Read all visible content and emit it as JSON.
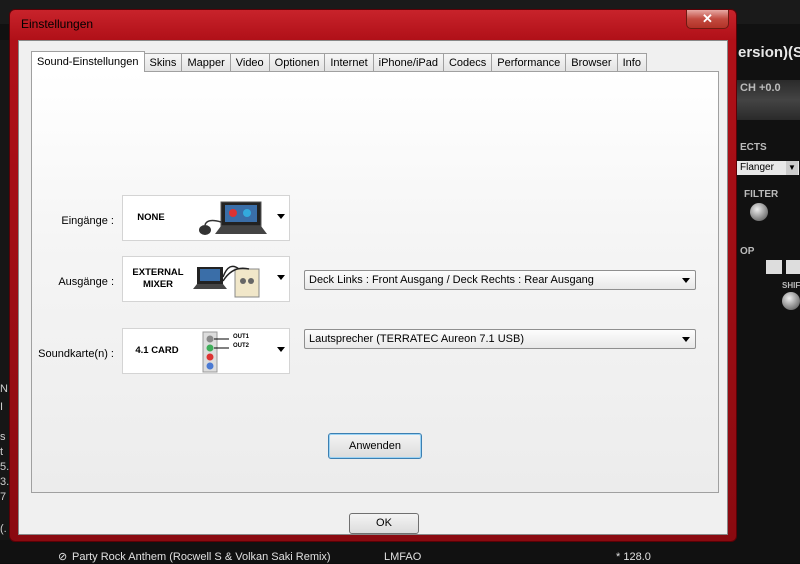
{
  "dialog": {
    "title": "Einstellungen",
    "close_label": "✕",
    "tabs": [
      "Sound-Einstellungen",
      "Skins",
      "Mapper",
      "Video",
      "Optionen",
      "Internet",
      "iPhone/iPad",
      "Codecs",
      "Performance",
      "Browser",
      "Info"
    ],
    "active_tab": "Sound-Einstellungen",
    "inputs": {
      "label": "Eingänge :",
      "value": "NONE"
    },
    "outputs": {
      "label": "Ausgänge :",
      "value_line1": "EXTERNAL",
      "value_line2": "MIXER",
      "routing": "Deck Links : Front Ausgang / Deck Rechts : Rear Ausgang"
    },
    "soundcard": {
      "label": "Soundkarte(n) :",
      "value": "4.1 CARD",
      "out1": "OUT1",
      "out2": "OUT2",
      "device": "Lautsprecher (TERRATEC Aureon 7.1 USB)"
    },
    "apply_label": "Anwenden",
    "ok_label": "OK"
  },
  "background": {
    "deck_title": "ersion)(Sc",
    "pitch": "CH +0.0",
    "effects_label": "ECTS",
    "effect": "Flanger",
    "filter_label": "FILTER",
    "loop_label": "OP",
    "shift_label": "SHIFT",
    "left_snippets": [
      "N",
      "I",
      "s",
      "t",
      "5.",
      "3.",
      "7",
      "(."
    ],
    "track_title": "Party Rock Anthem (Rocwell S & Volkan Saki Remix)",
    "track_artist": "LMFAO",
    "track_bpm": "* 128.0"
  },
  "colors": {
    "frame_red": "#b01018",
    "accent_blue": "#3c7fb1"
  }
}
